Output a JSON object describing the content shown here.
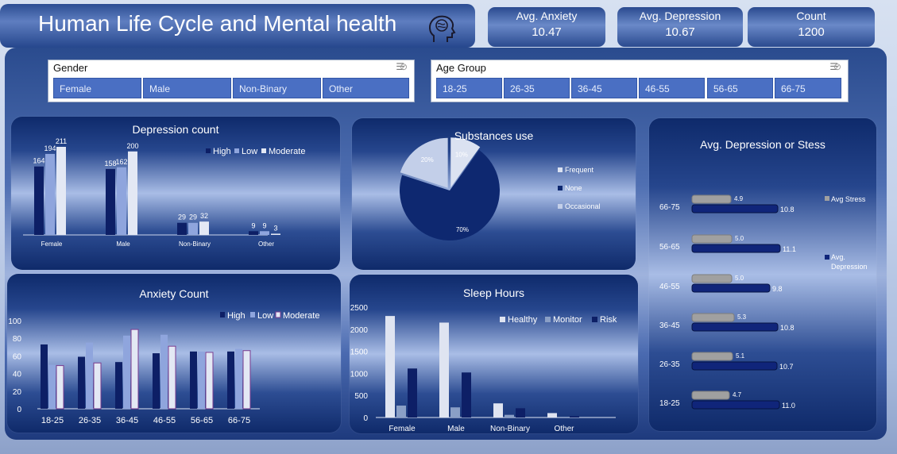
{
  "header": {
    "title": "Human Life Cycle and Mental health",
    "brain_icon": "brain-head-icon"
  },
  "kpis": [
    {
      "label": "Avg. Anxiety",
      "value": "10.47"
    },
    {
      "label": "Avg. Depression",
      "value": "10.67"
    },
    {
      "label": "Count",
      "value": "1200"
    }
  ],
  "slicers": {
    "gender": {
      "title": "Gender",
      "items": [
        "Female",
        "Male",
        "Non-Binary",
        "Other"
      ]
    },
    "age": {
      "title": "Age Group",
      "items": [
        "18-25",
        "26-35",
        "36-45",
        "46-55",
        "56-65",
        "66-75"
      ]
    }
  },
  "colors": {
    "high": "#0d1f66",
    "low": "#8fa5dd",
    "moderate": "#e3e8f4",
    "stress": "#a0a0a0",
    "depression": "#10257a"
  },
  "chart_data": [
    {
      "id": "depression",
      "type": "bar",
      "title": "Depression count",
      "categories": [
        "Female",
        "Male",
        "Non-Binary",
        "Other"
      ],
      "series": [
        {
          "name": "High",
          "values": [
            164,
            158,
            29,
            9
          ]
        },
        {
          "name": "Low",
          "values": [
            194,
            162,
            29,
            9
          ]
        },
        {
          "name": "Moderate",
          "values": [
            211,
            200,
            32,
            3
          ]
        }
      ],
      "legend": "top-right"
    },
    {
      "id": "substances",
      "type": "pie",
      "title": "Substances use",
      "slices": [
        {
          "name": "Frequent",
          "value": 10,
          "label": "10%"
        },
        {
          "name": "None",
          "value": 70,
          "label": "70%"
        },
        {
          "name": "Occasional",
          "value": 20,
          "label": "20%"
        }
      ],
      "legend": "right"
    },
    {
      "id": "stress",
      "type": "bar",
      "title": "Avg. Depression or Stess",
      "categories": [
        "66-75",
        "56-65",
        "46-55",
        "36-45",
        "26-35",
        "18-25"
      ],
      "series": [
        {
          "name": "Avg Stress",
          "values": [
            4.9,
            5.0,
            5.0,
            5.3,
            5.1,
            4.7
          ],
          "labels": [
            "4.9",
            "5.0",
            "5.0",
            "5.3",
            "5.1",
            "4.7"
          ]
        },
        {
          "name": "Avg. Depression",
          "values": [
            10.8,
            11.1,
            9.8,
            10.8,
            10.7,
            11.0
          ],
          "labels": [
            "10.8",
            "11.1",
            "9.8",
            "10.8",
            "10.7",
            "11.0"
          ]
        }
      ],
      "legend": "right"
    },
    {
      "id": "anxiety",
      "type": "bar",
      "title": "Anxiety Count",
      "categories": [
        "18-25",
        "26-35",
        "36-45",
        "46-55",
        "56-65",
        "66-75"
      ],
      "series": [
        {
          "name": "High",
          "values": [
            73,
            59,
            53,
            63,
            65,
            65
          ]
        },
        {
          "name": "Low",
          "values": [
            50,
            75,
            83,
            84,
            65,
            68
          ]
        },
        {
          "name": "Moderate",
          "values": [
            49,
            52,
            90,
            71,
            64,
            66
          ]
        }
      ],
      "yticks": [
        "0",
        "20",
        "40",
        "60",
        "80",
        "100"
      ],
      "ylim": [
        0,
        100
      ],
      "legend": "top-right"
    },
    {
      "id": "sleep",
      "type": "bar",
      "title": "Sleep Hours",
      "categories": [
        "Female",
        "Male",
        "Non-Binary",
        "Other"
      ],
      "series": [
        {
          "name": "Healthy",
          "values": [
            2300,
            2150,
            320,
            100
          ]
        },
        {
          "name": "Monitor",
          "values": [
            270,
            230,
            60,
            15
          ]
        },
        {
          "name": "Risk",
          "values": [
            1110,
            1020,
            210,
            30
          ]
        }
      ],
      "yticks": [
        "0",
        "500",
        "1000",
        "1500",
        "2000",
        "2500"
      ],
      "ylim": [
        0,
        2500
      ],
      "legend": "top-right"
    }
  ]
}
